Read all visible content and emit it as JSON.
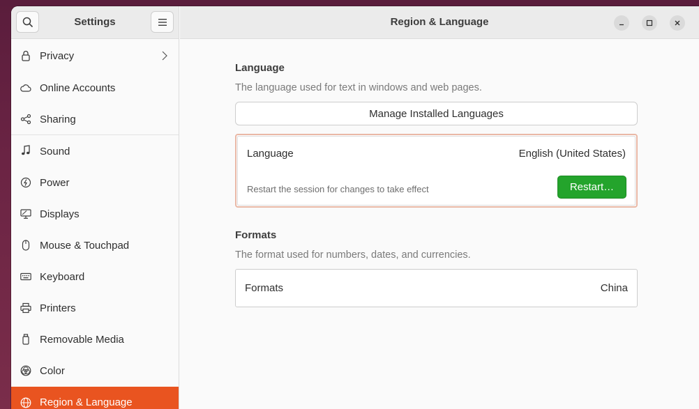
{
  "sidebar": {
    "title": "Settings",
    "items": [
      {
        "label": "Privacy",
        "icon": "lock-icon"
      },
      {
        "label": "Online Accounts",
        "icon": "cloud-icon"
      },
      {
        "label": "Sharing",
        "icon": "share-icon"
      },
      {
        "label": "Sound",
        "icon": "music-note-icon"
      },
      {
        "label": "Power",
        "icon": "power-icon"
      },
      {
        "label": "Displays",
        "icon": "display-icon"
      },
      {
        "label": "Mouse & Touchpad",
        "icon": "mouse-icon"
      },
      {
        "label": "Keyboard",
        "icon": "keyboard-icon"
      },
      {
        "label": "Printers",
        "icon": "printer-icon"
      },
      {
        "label": "Removable Media",
        "icon": "usb-drive-icon"
      },
      {
        "label": "Color",
        "icon": "color-icon"
      },
      {
        "label": "Region & Language",
        "icon": "globe-icon"
      }
    ],
    "active_index": 11
  },
  "header": {
    "title": "Region & Language"
  },
  "language_section": {
    "title": "Language",
    "subtitle": "The language used for text in windows and web pages.",
    "manage_button": "Manage Installed Languages",
    "row_label": "Language",
    "row_value": "English (United States)",
    "restart_note": "Restart the session for changes to take effect",
    "restart_button": "Restart…"
  },
  "formats_section": {
    "title": "Formats",
    "subtitle": "The format used for numbers, dates, and currencies.",
    "row_label": "Formats",
    "row_value": "China"
  },
  "colors": {
    "accent": "#e95420",
    "restart_green": "#24a42c"
  }
}
